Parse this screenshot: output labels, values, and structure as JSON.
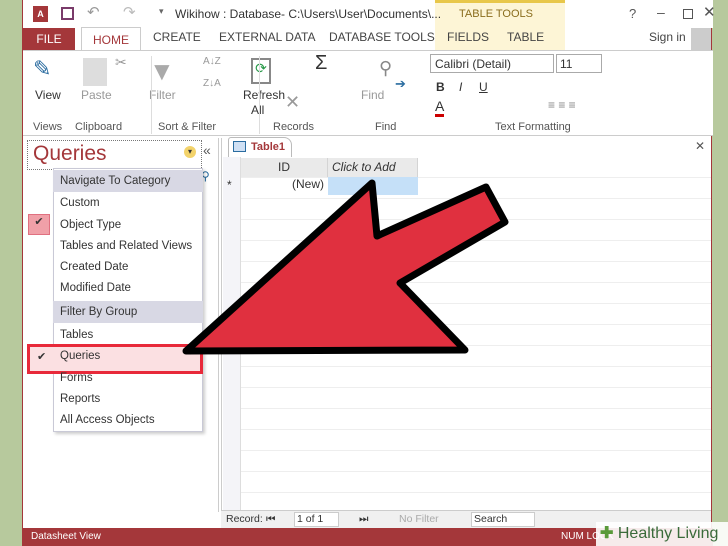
{
  "window": {
    "title": "Wikihow : Database- C:\\Users\\User\\Documents\\...",
    "context_group": "TABLE TOOLS",
    "help": "?",
    "sign_in": "Sign in"
  },
  "tabs": [
    "FILE",
    "HOME",
    "CREATE",
    "EXTERNAL DATA",
    "DATABASE TOOLS",
    "FIELDS",
    "TABLE"
  ],
  "ribbon": {
    "groups": [
      "Views",
      "Clipboard",
      "Sort & Filter",
      "Records",
      "Find",
      "Text Formatting"
    ],
    "view": "View",
    "paste": "Paste",
    "filter": "Filter",
    "refresh": "Refresh",
    "refresh_all": "All",
    "find": "Find",
    "font_name": "Calibri (Detail)",
    "font_size": "11",
    "bold": "B",
    "italic": "I",
    "underline": "U"
  },
  "nav": {
    "title": "Queries",
    "collapse": "«",
    "menu": {
      "header1": "Navigate To Category",
      "items1": [
        {
          "label": "Custom",
          "checked": false
        },
        {
          "label": "Object Type",
          "checked": true
        },
        {
          "label": "Tables and Related Views",
          "checked": false
        },
        {
          "label": "Created Date",
          "checked": false
        },
        {
          "label": "Modified Date",
          "checked": false
        }
      ],
      "header2": "Filter By Group",
      "items2": [
        {
          "label": "Tables",
          "checked": false
        },
        {
          "label": "Queries",
          "checked": true
        },
        {
          "label": "Forms",
          "checked": false
        },
        {
          "label": "Reports",
          "checked": false
        },
        {
          "label": "All Access Objects",
          "checked": false
        }
      ]
    }
  },
  "document": {
    "tab": "Table1",
    "columns": [
      "ID",
      "Click to Add"
    ],
    "new_row_marker": "*",
    "new_row_value": "(New)"
  },
  "record_bar": {
    "label": "Record:",
    "position": "1 of 1",
    "filter": "No Filter",
    "search": "Search"
  },
  "status": {
    "left": "Datasheet View",
    "right": "NUM LOCK"
  },
  "watermark": "Healthy Living",
  "colors": {
    "accent": "#a4373a",
    "arrow": "#e0303f",
    "highlight": "#e8293a"
  }
}
